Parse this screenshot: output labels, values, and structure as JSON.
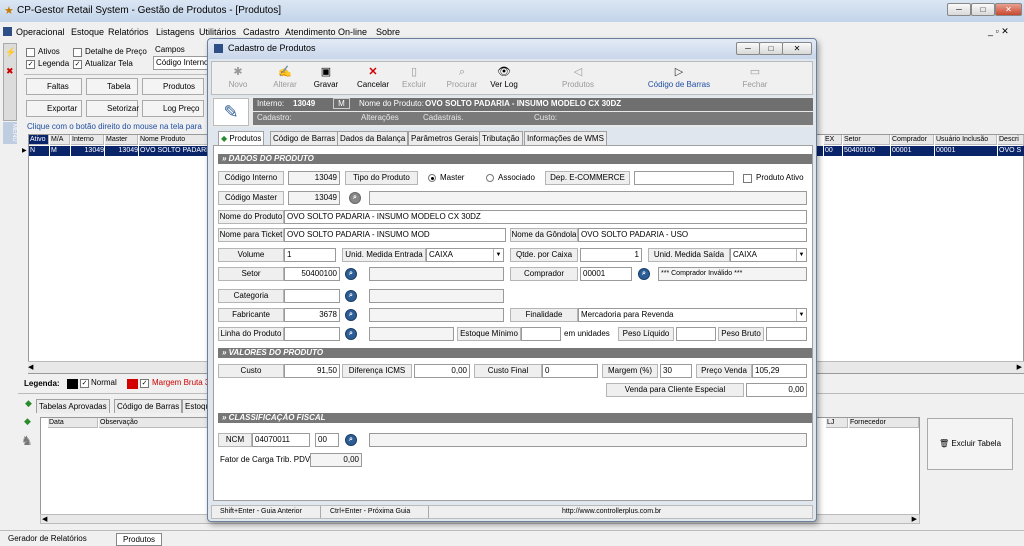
{
  "app": {
    "title": "CP-Gestor Retail System - Gestão de Produtos - [Produtos]"
  },
  "menu": [
    "Operacional",
    "Estoque",
    "Relatórios",
    "Listagens",
    "Utilitários",
    "Cadastro",
    "Atendimento On-line",
    "Sobre"
  ],
  "left": {
    "ativos": "Ativos",
    "detalhe": "Detalhe de Preço",
    "campos": "Campos",
    "legenda": "Legenda",
    "atualizar": "Atualizar Tela",
    "codigo": "Código Interno",
    "faltas": "Faltas",
    "tabela": "Tabela",
    "produtos": "Produtos",
    "exportar": "Exportar",
    "setorizar": "Setorizar",
    "logpreco": "Log Preço",
    "hint": "Clique com o botão direito do mouse na tela para",
    "side_menu": "MENU"
  },
  "grid": {
    "headers": [
      "Ativo",
      "M/A",
      "Interno",
      "Master",
      "Nome Produto"
    ],
    "row": [
      "N",
      "M",
      "13049",
      "13049",
      "OVO SOLTO PADARI"
    ],
    "right_headers": [
      "EX",
      "Setor",
      "Comprador",
      "Usuário Inclusão",
      "Descri"
    ],
    "right_row": [
      "00",
      "50400100",
      "00001",
      "00001",
      "OVO S"
    ]
  },
  "legend": {
    "label": "Legenda:",
    "normal": "Normal",
    "margem": "Margem Bruta 3"
  },
  "bottom": {
    "tabs": [
      "Tabelas Aprovadas",
      "Código de Barras",
      "Estoqu"
    ],
    "cols": [
      "Data",
      "Observação"
    ],
    "right_cols": [
      "LJ",
      "Fornecedor"
    ],
    "excluir": "Excluir Tabela"
  },
  "taskbar": {
    "item1": "Gerador de Relatórios",
    "item2": "Produtos"
  },
  "dialog": {
    "title": "Cadastro de Produtos",
    "toolbar": {
      "novo": "Novo",
      "alterar": "Alterar",
      "gravar": "Gravar",
      "cancelar": "Cancelar",
      "excluir": "Excluir",
      "procurar": "Procurar",
      "verlog": "Ver Log",
      "produtos": "Produtos",
      "codbarras": "Código de Barras",
      "fechar": "Fechar"
    },
    "header": {
      "interno_label": "Interno:",
      "interno_value": "13049",
      "m": "M",
      "nome_label": "Nome do Produto:",
      "nome_value": "OVO SOLTO PADARIA - INSUMO MODELO CX 30DZ",
      "cadastro": "Cadastro:",
      "alteracoes": "Alterações",
      "cadastrais": "Cadastrais.",
      "custo": "Custo:"
    },
    "tabs": [
      "Produtos",
      "Código de Barras",
      "Dados da Balança",
      "Parâmetros Gerais",
      "Tributação",
      "Informações de WMS"
    ],
    "sec1": "» DADOS DO PRODUTO",
    "codigo_interno_label": "Código Interno",
    "codigo_interno": "13049",
    "tipo_label": "Tipo do Produto",
    "master": "Master",
    "associado": "Associado",
    "dep_label": "Dep. E-COMMERCE",
    "produto_ativo": "Produto Ativo",
    "codigo_master_label": "Código Master",
    "codigo_master": "13049",
    "nome_label": "Nome do Produto",
    "nome": "OVO SOLTO PADARIA - INSUMO MODELO CX 30DZ",
    "ticket_label": "Nome para Ticket",
    "ticket": "OVO SOLTO PADARIA - INSUMO MOD",
    "gondola_label": "Nome da Gôndola",
    "gondola": "OVO SOLTO PADARIA - USO",
    "volume_label": "Volume",
    "volume": "1",
    "um_entrada_label": "Unid. Medida Entrada",
    "um_entrada": "CAIXA",
    "qtde_label": "Qtde. por Caixa",
    "qtde": "1",
    "um_saida_label": "Unid. Medida Saída",
    "um_saida": "CAIXA",
    "setor_label": "Setor",
    "setor": "50400100",
    "comprador_label": "Comprador",
    "comprador": "00001",
    "comprador_inv": "*** Comprador Inválido ***",
    "categoria_label": "Categoria",
    "fabricante_label": "Fabricante",
    "fabricante": "3678",
    "finalidade_label": "Finalidade",
    "finalidade": "Mercadoria para Revenda",
    "linha_label": "Linha do Produto",
    "estoque_min_label": "Estoque Mínimo",
    "em_unidades": "em unidades",
    "peso_liq_label": "Peso Líquido",
    "peso_bruto_label": "Peso Bruto",
    "sec2": "» VALORES DO PRODUTO",
    "custo_label": "Custo",
    "custo": "91,50",
    "dif_icms_label": "Diferença ICMS",
    "dif_icms": "0,00",
    "custo_final_label": "Custo Final",
    "custo_final": "0",
    "margem_label": "Margem (%)",
    "margem": "30",
    "preco_venda_label": "Preço Venda",
    "preco_venda": "105,29",
    "venda_esp_label": "Venda para Cliente Especial",
    "venda_esp": "0,00",
    "sec3": "» CLASSIFICAÇÃO FISCAL",
    "ncm_label": "NCM",
    "ncm": "04070011",
    "ncm_ex": "00",
    "fator_label": "Fator de Carga Trib. PDV",
    "fator": "0,00",
    "status": {
      "prev": "Shift+Enter - Guia Anterior",
      "next": "Ctrl+Enter - Próxima Guia",
      "url": "http://www.controllerplus.com.br"
    }
  }
}
